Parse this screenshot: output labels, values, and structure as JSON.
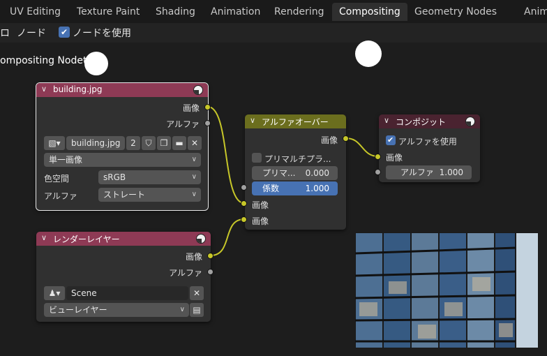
{
  "tabs": [
    {
      "label": "UV Editing",
      "active": false
    },
    {
      "label": "Texture Paint",
      "active": false
    },
    {
      "label": "Shading",
      "active": false
    },
    {
      "label": "Animation",
      "active": false
    },
    {
      "label": "Rendering",
      "active": false
    },
    {
      "label": "Compositing",
      "active": true
    },
    {
      "label": "Geometry Nodes",
      "active": false
    },
    {
      "label": "Anim",
      "active": false
    }
  ],
  "editor_header": {
    "edge_label": "ロ",
    "node_menu": "ノード",
    "use_nodes_label": "ノードを使用",
    "use_nodes_checked": true,
    "tree_name": "ompositing Nodetree"
  },
  "nodes": {
    "image": {
      "title": "building.jpg",
      "out_image": "画像",
      "out_alpha": "アルファ",
      "image_name": "building.jpg",
      "users": "2",
      "source": "単一画像",
      "colorspace_label": "色空間",
      "colorspace_value": "sRGB",
      "alpha_label": "アルファ",
      "alpha_value": "ストレート"
    },
    "render_layers": {
      "title": "レンダーレイヤー",
      "out_image": "画像",
      "out_alpha": "アルファ",
      "scene": "Scene",
      "view_layer": "ビューレイヤー"
    },
    "alpha_over": {
      "title": "アルファオーバー",
      "out_image": "画像",
      "premultiply_convert": "プリマルチプラ...",
      "premultiply_label": "プリマ...",
      "premultiply_value": "0.000",
      "factor_label": "係数",
      "factor_value": "1.000",
      "in_image_1": "画像",
      "in_image_2": "画像"
    },
    "composite": {
      "title": "コンポジット",
      "use_alpha_label": "アルファを使用",
      "use_alpha_checked": true,
      "in_image": "画像",
      "in_alpha_label": "アルファ",
      "in_alpha_value": "1.000"
    }
  },
  "colors": {
    "input_header": "#8e3a55",
    "converter_header": "#6b6e1e",
    "output_header": "#4a2330",
    "socket_color": "#c7c729",
    "socket_value": "#a1a1a1",
    "accent": "#4772b3",
    "link": "#c7c729"
  }
}
